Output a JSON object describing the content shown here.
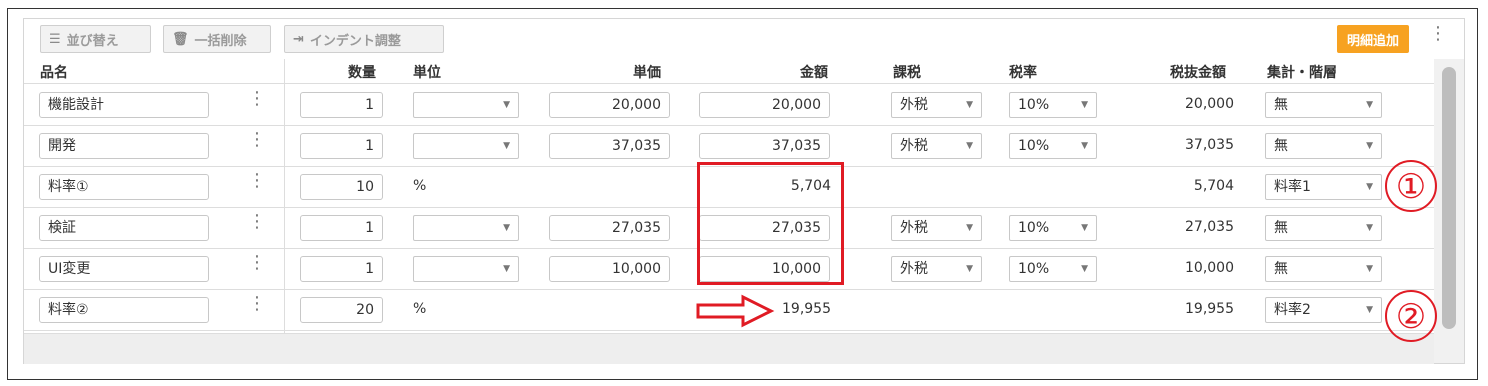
{
  "toolbar": {
    "sort_label": "並び替え",
    "bulk_delete_label": "一括削除",
    "indent_label": "インデント調整",
    "add_line_label": "明細追加"
  },
  "columns": [
    "品名",
    "数量",
    "単位",
    "単価",
    "金額",
    "課税",
    "税率",
    "税抜金額",
    "集計・階層"
  ],
  "rows": [
    {
      "name": "機能設計",
      "qty": "1",
      "unit": "",
      "price": "20,000",
      "amount": "20,000",
      "tax": "外税",
      "rate": "10%",
      "net": "20,000",
      "group": "無",
      "type": "item"
    },
    {
      "name": "開発",
      "qty": "1",
      "unit": "",
      "price": "37,035",
      "amount": "37,035",
      "tax": "外税",
      "rate": "10%",
      "net": "37,035",
      "group": "無",
      "type": "item"
    },
    {
      "name": "料率①",
      "qty": "10",
      "unit": "%",
      "price": "",
      "amount": "5,704",
      "tax": "",
      "rate": "",
      "net": "5,704",
      "group": "料率1",
      "type": "rate"
    },
    {
      "name": "検証",
      "qty": "1",
      "unit": "",
      "price": "27,035",
      "amount": "27,035",
      "tax": "外税",
      "rate": "10%",
      "net": "27,035",
      "group": "無",
      "type": "item"
    },
    {
      "name": "UI変更",
      "qty": "1",
      "unit": "",
      "price": "10,000",
      "amount": "10,000",
      "tax": "外税",
      "rate": "10%",
      "net": "10,000",
      "group": "無",
      "type": "item"
    },
    {
      "name": "料率②",
      "qty": "20",
      "unit": "%",
      "price": "",
      "amount": "19,955",
      "tax": "",
      "rate": "",
      "net": "19,955",
      "group": "料率2",
      "type": "rate"
    }
  ],
  "annotations": {
    "circle1": "①",
    "circle2": "②"
  },
  "colors": {
    "accent": "#f7a221",
    "highlight": "#e01b24"
  }
}
